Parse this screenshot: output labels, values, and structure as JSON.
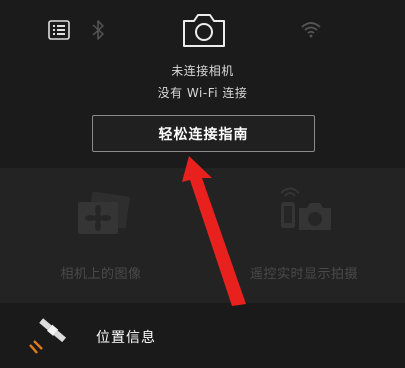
{
  "header": {
    "status_line1": "未连接相机",
    "status_line2": "没有 Wi-Fi 连接",
    "guide_button_label": "轻松连接指南"
  },
  "features": [
    {
      "label": "相机上的图像",
      "icon": "camera-images-icon"
    },
    {
      "label": "遥控实时显示拍摄",
      "icon": "remote-live-view-icon"
    }
  ],
  "location": {
    "label": "位置信息",
    "icon": "satellite-icon"
  },
  "colors": {
    "background": "#1e1e1e",
    "disabled_text": "#4a4a4a",
    "annotation_arrow": "#e8201e",
    "satellite_signal": "#e07a1a"
  }
}
